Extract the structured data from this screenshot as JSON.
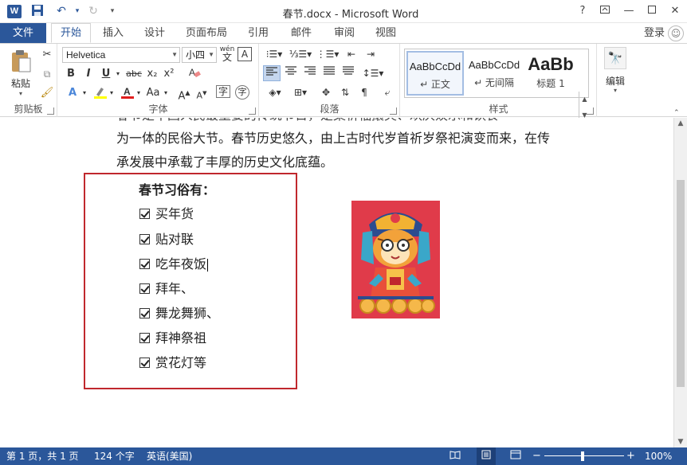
{
  "titlebar": {
    "app_icon": "W",
    "title": "春节.docx - Microsoft Word",
    "help": "?",
    "quick_access": [
      "save-icon",
      "undo-icon",
      "redo-icon",
      "customize-icon"
    ]
  },
  "tabs": {
    "file": "文件",
    "items": [
      "开始",
      "插入",
      "设计",
      "页面布局",
      "引用",
      "邮件",
      "审阅",
      "视图"
    ],
    "active": "开始",
    "login": "登录"
  },
  "ribbon": {
    "clipboard": {
      "label": "剪贴板",
      "paste": "粘贴"
    },
    "font": {
      "label": "字体",
      "font_name": "Helvetica",
      "font_size": "小四",
      "wen": "wén",
      "wen_char": "文",
      "a_box": "A",
      "bold": "B",
      "italic": "I",
      "underline": "U",
      "strike": "abc",
      "sub": "x₂",
      "sup": "x²",
      "grow": "A",
      "shrink": "A",
      "case": "Aa"
    },
    "paragraph": {
      "label": "段落"
    },
    "styles": {
      "label": "样式",
      "items": [
        {
          "sample": "AaBbCcDd",
          "name": "↵ 正文"
        },
        {
          "sample": "AaBbCcDd",
          "name": "↵ 无间隔"
        },
        {
          "sample": "AaBb",
          "name": "标题 1"
        }
      ]
    },
    "editing": {
      "label": "编辑"
    }
  },
  "document": {
    "line_partial": "春节是中国人民最重要的传统节日，是集祈福攘灾、欢庆娱乐和饮食",
    "line1": "为一体的民俗大节。春节历史悠久，由上古时代岁首祈岁祭祀演变而来，在传",
    "line2": "承发展中承载了丰厚的历史文化底蕴。",
    "list_heading": "春节习俗有：",
    "checklist": [
      "买年货",
      "贴对联",
      "吃年夜饭",
      "拜年、",
      "舞龙舞狮、",
      "拜神祭祖",
      "赏花灯等"
    ],
    "image": "tiger-illustration",
    "colors": {
      "border": "#c0282d",
      "image_bg": "#e03b4a"
    }
  },
  "status": {
    "page": "第 1 页，共 1 页",
    "words": "124 个字",
    "language": "英语(美国)",
    "zoom": "100%",
    "zoom_minus": "−",
    "zoom_plus": "+"
  },
  "colors": {
    "accent": "#2b579a"
  }
}
